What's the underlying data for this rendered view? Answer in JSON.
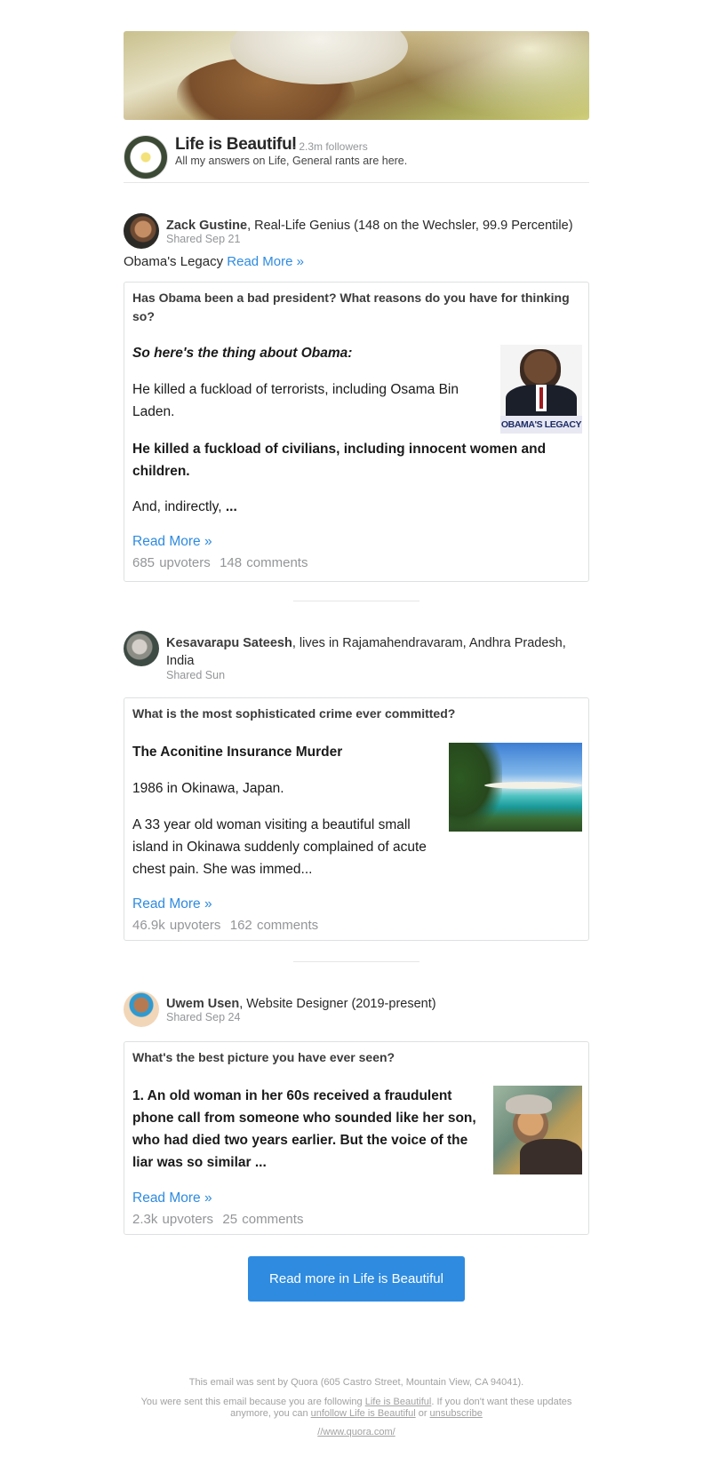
{
  "space": {
    "name": "Life is Beautiful",
    "followers": "· 2.3m followers",
    "description": "All my answers on Life, General rants are here."
  },
  "stories": [
    {
      "author_name": "Zack Gustine",
      "author_credential": ", Real-Life Genius (148 on the Wechsler, 99.9 Percentile)",
      "shared": "Shared Sep 21",
      "teaser": "Obama's Legacy",
      "teaser_link": "Read More »",
      "question": "Has Obama been a bad president? What reasons do you have for thinking so?",
      "p1": "So here's the thing about Obama:",
      "p2": "He killed a fuckload of terrorists, including Osama Bin Laden.",
      "p3": "He killed a fuckload of civilians, including innocent women and children.",
      "p4": "And, indirectly,",
      "p4_tail": "...",
      "thumb_caption": "OBAMA'S LEGACY",
      "read_more": "Read More »",
      "upvoters": "685 upvoters",
      "comments": "148 comments"
    },
    {
      "author_name": "Kesavarapu Sateesh",
      "author_credential": ", lives in Rajamahendravaram, Andhra Pradesh, India",
      "shared": "Shared Sun",
      "question": "What is the most sophisticated crime ever committed?",
      "p1": "The Aconitine Insurance Murder",
      "p2": "1986 in Okinawa, Japan.",
      "p3": "A 33 year old woman visiting a beautiful small island in Okinawa suddenly complained of acute chest pain. She was immed...",
      "read_more": "Read More »",
      "upvoters": "46.9k upvoters",
      "comments": "162 comments"
    },
    {
      "author_name": "Uwem Usen",
      "author_credential": ", Website Designer (2019-present)",
      "shared": "Shared Sep 24",
      "question": "What's the best picture you have ever seen?",
      "p1": "1. An old woman in her 60s received a fraudulent phone call from someone who sounded like her son, who had died two years earlier. But the voice of the liar was so similar ...",
      "read_more": "Read More »",
      "upvoters": "2.3k upvoters",
      "comments": "25 comments"
    }
  ],
  "cta": "Read more in Life is Beautiful",
  "footer": {
    "line1": "This email was sent by Quora (605 Castro Street, Mountain View, CA 94041).",
    "line2_a": "You were sent this email because you are following",
    "line2_link1": "Life is Beautiful",
    "line2_b": ". If you don't want these updates anymore, you can",
    "line2_link2": "unfollow Life is Beautiful",
    "line2_c": "or",
    "line2_link3": "unsubscribe",
    "line3": "//www.quora.com/"
  }
}
